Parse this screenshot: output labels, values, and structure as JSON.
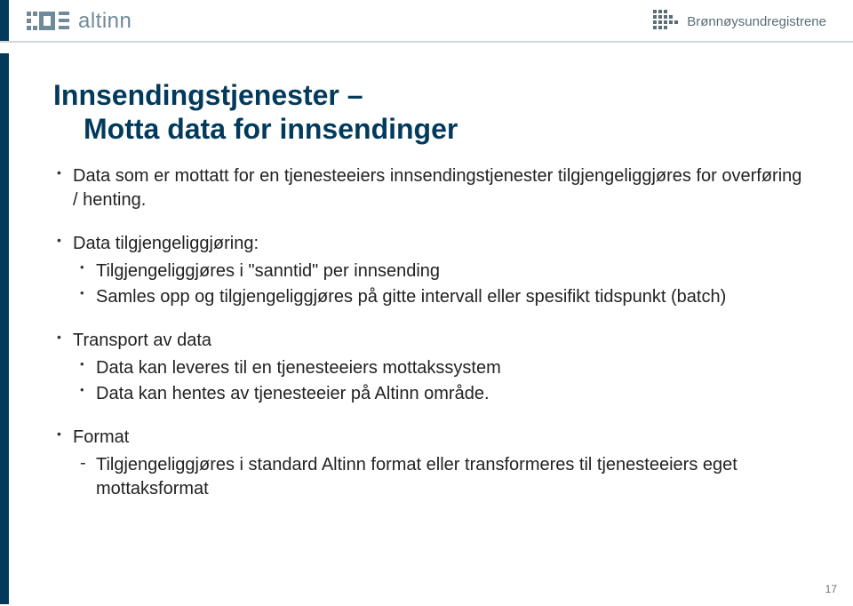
{
  "header": {
    "left_logo_text": "altinn",
    "right_logo_text": "Brønnøysundregistrene"
  },
  "title": {
    "line1": "Innsendingstjenester –",
    "line2": "Motta data for innsendinger"
  },
  "bullets": {
    "item1": "Data som er mottatt for en tjenesteeiers innsendingstjenester tilgjengeliggjøres for overføring / henting.",
    "item2": {
      "text": "Data tilgjengeliggjøring:",
      "sub1": "Tilgjengeliggjøres i \"sanntid\" per innsending",
      "sub2": "Samles opp og tilgjengeliggjøres på gitte intervall eller spesifikt tidspunkt (batch)"
    },
    "item3": {
      "text": "Transport av data",
      "sub1": "Data kan leveres til en tjenesteeiers mottakssystem",
      "sub2": "Data kan hentes av tjenesteeier på Altinn område."
    },
    "item4": {
      "text": "Format",
      "sub1": "Tilgjengeliggjøres i standard Altinn format eller transformeres til tjenesteeiers eget mottaksformat"
    }
  },
  "page_number": "17"
}
